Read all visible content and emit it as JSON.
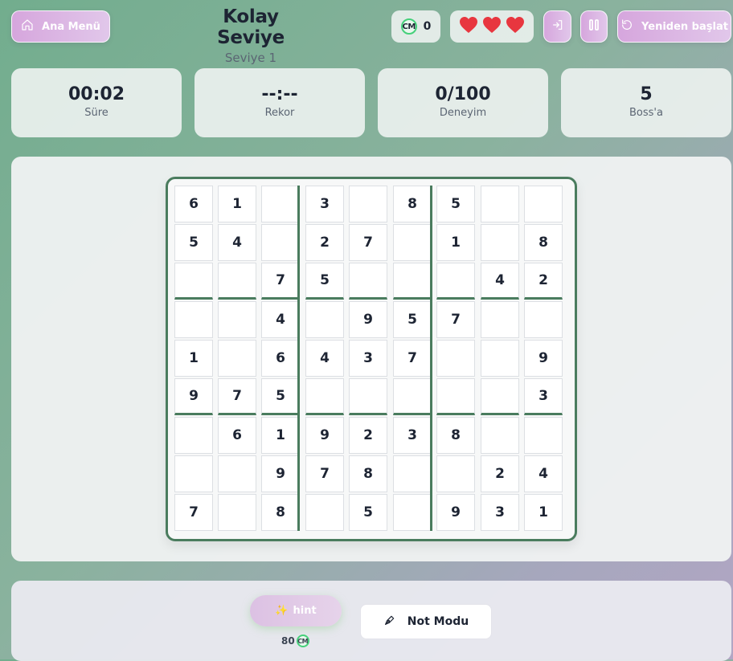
{
  "header": {
    "home_label": "Ana Menü",
    "title": "Kolay Seviye",
    "subtitle": "Seviye 1",
    "coins": "0",
    "coin_symbol": "CM",
    "lives": 3,
    "restart_label": "Yeniden başlat"
  },
  "stats": [
    {
      "value": "00:02",
      "label": "Süre"
    },
    {
      "value": "--:--",
      "label": "Rekor"
    },
    {
      "value": "0/100",
      "label": "Deneyim"
    },
    {
      "value": "5",
      "label": "Boss'a"
    }
  ],
  "board": [
    [
      "6",
      "1",
      "",
      "3",
      "",
      "8",
      "5",
      "",
      ""
    ],
    [
      "5",
      "4",
      "",
      "2",
      "7",
      "",
      "1",
      "",
      "8"
    ],
    [
      "",
      "",
      "7",
      "5",
      "",
      "",
      "",
      "4",
      "2"
    ],
    [
      "",
      "",
      "4",
      "",
      "9",
      "5",
      "7",
      "",
      ""
    ],
    [
      "1",
      "",
      "6",
      "4",
      "3",
      "7",
      "",
      "",
      "9"
    ],
    [
      "9",
      "7",
      "5",
      "",
      "",
      "",
      "",
      "",
      "3"
    ],
    [
      "",
      "6",
      "1",
      "9",
      "2",
      "3",
      "8",
      "",
      ""
    ],
    [
      "",
      "",
      "9",
      "7",
      "8",
      "",
      "",
      "2",
      "4"
    ],
    [
      "7",
      "",
      "8",
      "",
      "5",
      "",
      "9",
      "3",
      "1"
    ]
  ],
  "controls": {
    "hint_label": "hint",
    "hint_icon": "✨",
    "hint_cost": "80",
    "coin_symbol": "CM",
    "note_label": "Not Modu"
  },
  "colors": {
    "accent": "#d6a6dd",
    "board_border": "#4a7c5e",
    "heart": "#e8363f",
    "coin_ring": "#45d07a"
  }
}
